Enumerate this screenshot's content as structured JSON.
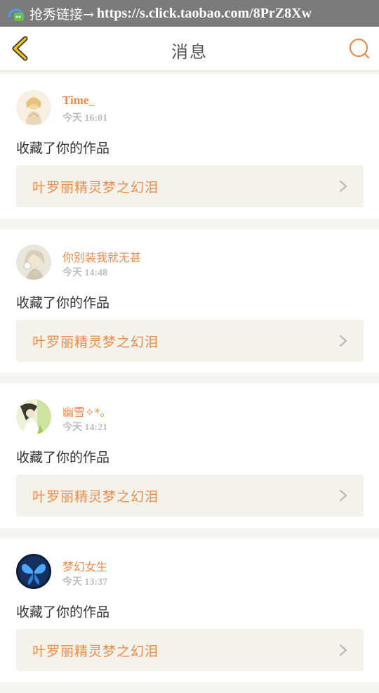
{
  "status": {
    "prefix": "抢秀链接→",
    "url": "https://s.click.taobao.com/8PrZ8Xw"
  },
  "nav": {
    "title": "消息",
    "back_icon": "chevron-left-icon",
    "search_icon": "search-icon"
  },
  "colors": {
    "accent": "#f08a4b",
    "back_arrow": "#f5c200",
    "card_highlight": "#f3f3ec"
  },
  "messages": [
    {
      "username": "Time_",
      "time": "今天 16:01",
      "action": "收藏了你的作品",
      "work_title": "叶罗丽精灵梦之幻泪"
    },
    {
      "username": "你别装我就无甚",
      "time": "今天 14:48",
      "action": "收藏了你的作品",
      "work_title": "叶罗丽精灵梦之幻泪"
    },
    {
      "username": "幽雪✧*。",
      "time": "今天 14:21",
      "action": "收藏了你的作品",
      "work_title": "叶罗丽精灵梦之幻泪"
    },
    {
      "username": "梦幻女生",
      "time": "今天 13:37",
      "action": "收藏了你的作品",
      "work_title": "叶罗丽精灵梦之幻泪"
    }
  ]
}
